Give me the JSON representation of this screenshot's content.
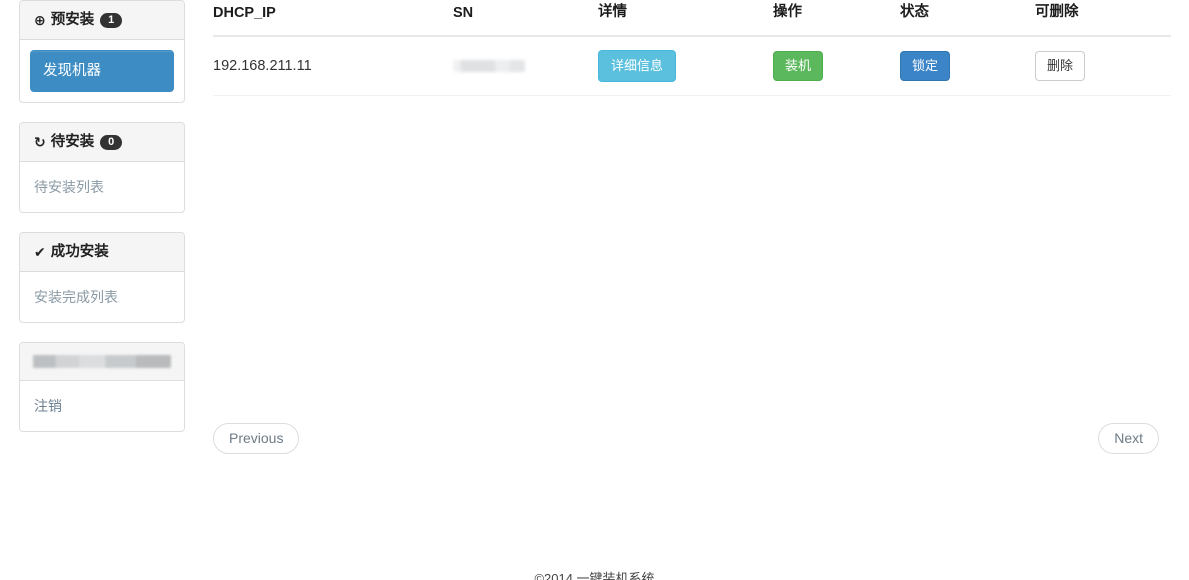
{
  "sidebar": {
    "groups": [
      {
        "icon": "plus-circle-icon",
        "icon_glyph": "⊕",
        "title": "预安装",
        "badge": "1",
        "link_label": "发现机器",
        "active": true
      },
      {
        "icon": "refresh-icon",
        "icon_glyph": "↻",
        "title": "待安装",
        "badge": "0",
        "link_label": "待安装列表",
        "active": false
      },
      {
        "icon": "check-icon",
        "icon_glyph": "✔",
        "title": "成功安装",
        "badge": "",
        "link_label": "安装完成列表",
        "active": false
      }
    ],
    "user_panel": {
      "username_redacted": "",
      "logout_label": "注销"
    }
  },
  "table": {
    "headers": [
      "DHCP_IP",
      "SN",
      "详情",
      "操作",
      "状态",
      "可删除"
    ],
    "rows": [
      {
        "dhcp_ip": "192.168.211.11",
        "sn_redacted": "",
        "detail_label": "详细信息",
        "operation_label": "装机",
        "status_label": "锁定",
        "delete_label": "删除"
      }
    ]
  },
  "pagination": {
    "previous_label": "Previous",
    "next_label": "Next"
  },
  "footer": {
    "text": "©2014 一键装机系统"
  },
  "colors": {
    "active_nav": "#3d8dc4",
    "info": "#5bc0de",
    "success": "#5cb85c",
    "primary": "#3b84c8",
    "badge": "#333333",
    "panel_border": "#dddddd",
    "link": "#8a9aa5"
  }
}
